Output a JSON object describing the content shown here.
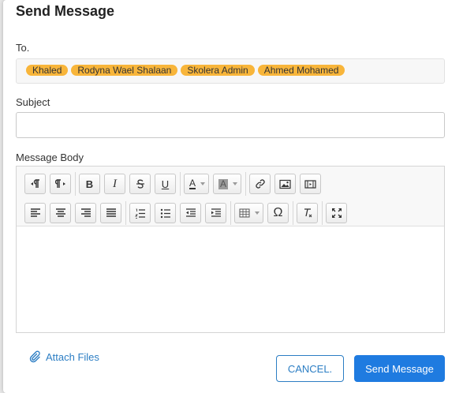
{
  "dialog": {
    "title": "Send Message",
    "to_label": "To.",
    "recipients": [
      "Khaled",
      "Rodyna Wael Shalaan",
      "Skolera Admin",
      "Ahmed Mohamed"
    ],
    "subject_label": "Subject",
    "subject_value": "",
    "body_label": "Message Body",
    "attach_label": "Attach Files",
    "cancel_label": "CANCEL.",
    "send_label": "Send Message"
  },
  "toolbar": {
    "bold": "B",
    "italic": "I",
    "underline": "U",
    "font_color": "A",
    "bg_color": "A",
    "special_char": "Ω"
  },
  "colors": {
    "accent": "#1f7be0",
    "chip": "#f8b53a",
    "link": "#2c7ec4"
  },
  "icons": [
    "ltr-paragraph-icon",
    "rtl-paragraph-icon",
    "bold-icon",
    "italic-icon",
    "strikethrough-icon",
    "underline-icon",
    "font-color-icon",
    "background-color-icon",
    "link-icon",
    "image-icon",
    "video-icon",
    "align-left-icon",
    "align-center-icon",
    "align-right-icon",
    "justify-icon",
    "ordered-list-icon",
    "unordered-list-icon",
    "outdent-icon",
    "indent-icon",
    "table-icon",
    "special-character-icon",
    "clear-format-icon",
    "fullscreen-icon",
    "paperclip-icon"
  ]
}
